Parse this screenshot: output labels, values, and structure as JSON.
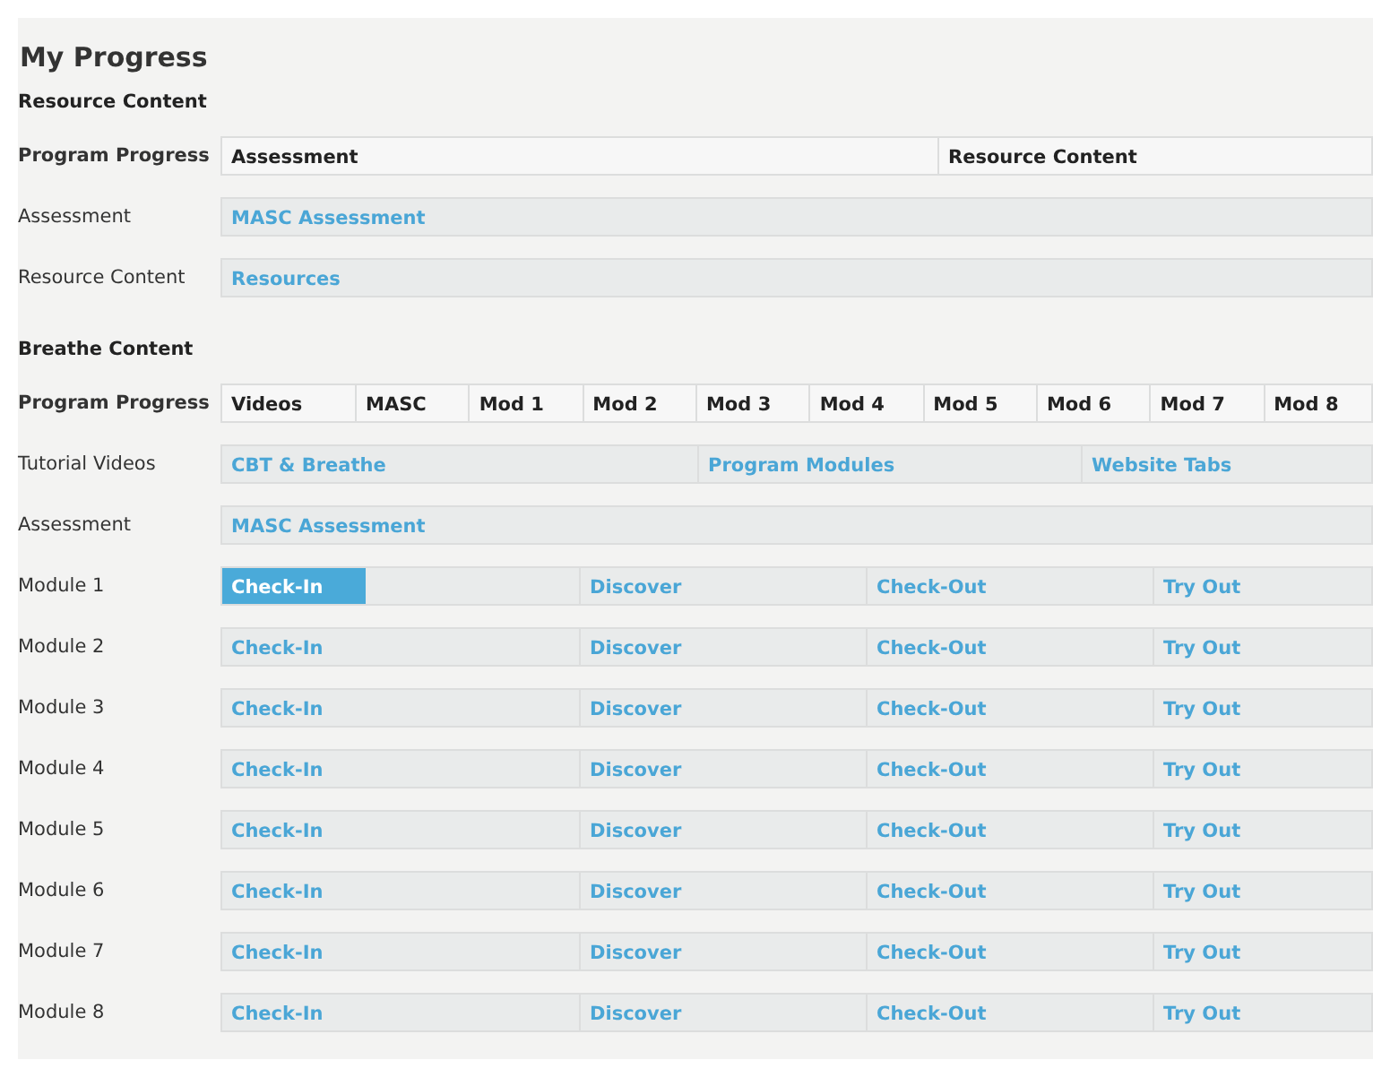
{
  "title": "My Progress",
  "sections": [
    {
      "heading": "Resource Content",
      "progress_header": {
        "label": "Program Progress",
        "headings": [
          "Assessment",
          "Resource Content"
        ]
      },
      "rows": [
        {
          "label": "Assessment",
          "links": [
            {
              "text": "MASC Assessment"
            }
          ]
        },
        {
          "label": "Resource Content",
          "links": [
            {
              "text": "Resources"
            }
          ]
        }
      ]
    },
    {
      "heading": "Breathe Content",
      "progress_header": {
        "label": "Program Progress",
        "headings": [
          "Videos",
          "MASC",
          "Mod 1",
          "Mod 2",
          "Mod 3",
          "Mod 4",
          "Mod 5",
          "Mod 6",
          "Mod 7",
          "Mod 8"
        ]
      },
      "rows": [
        {
          "label": "Tutorial Videos",
          "links": [
            {
              "text": "CBT & Breathe"
            },
            {
              "text": "Program Modules"
            },
            {
              "text": "Website Tabs"
            }
          ]
        },
        {
          "label": "Assessment",
          "links": [
            {
              "text": "MASC Assessment"
            }
          ]
        },
        {
          "label": "Module 1",
          "links": [
            {
              "text": "Check-In",
              "level": 0.4
            },
            {
              "text": "Discover"
            },
            {
              "text": "Check-Out"
            },
            {
              "text": "Try Out"
            }
          ]
        },
        {
          "label": "Module 2",
          "links": [
            {
              "text": "Check-In"
            },
            {
              "text": "Discover"
            },
            {
              "text": "Check-Out"
            },
            {
              "text": "Try Out"
            }
          ]
        },
        {
          "label": "Module 3",
          "links": [
            {
              "text": "Check-In"
            },
            {
              "text": "Discover"
            },
            {
              "text": "Check-Out"
            },
            {
              "text": "Try Out"
            }
          ]
        },
        {
          "label": "Module 4",
          "links": [
            {
              "text": "Check-In"
            },
            {
              "text": "Discover"
            },
            {
              "text": "Check-Out"
            },
            {
              "text": "Try Out"
            }
          ]
        },
        {
          "label": "Module 5",
          "links": [
            {
              "text": "Check-In"
            },
            {
              "text": "Discover"
            },
            {
              "text": "Check-Out"
            },
            {
              "text": "Try Out"
            }
          ]
        },
        {
          "label": "Module 6",
          "links": [
            {
              "text": "Check-In"
            },
            {
              "text": "Discover"
            },
            {
              "text": "Check-Out"
            },
            {
              "text": "Try Out"
            }
          ]
        },
        {
          "label": "Module 7",
          "links": [
            {
              "text": "Check-In"
            },
            {
              "text": "Discover"
            },
            {
              "text": "Check-Out"
            },
            {
              "text": "Try Out"
            }
          ]
        },
        {
          "label": "Module 8",
          "links": [
            {
              "text": "Check-In"
            },
            {
              "text": "Discover"
            },
            {
              "text": "Check-Out"
            },
            {
              "text": "Try Out"
            }
          ]
        }
      ]
    }
  ]
}
